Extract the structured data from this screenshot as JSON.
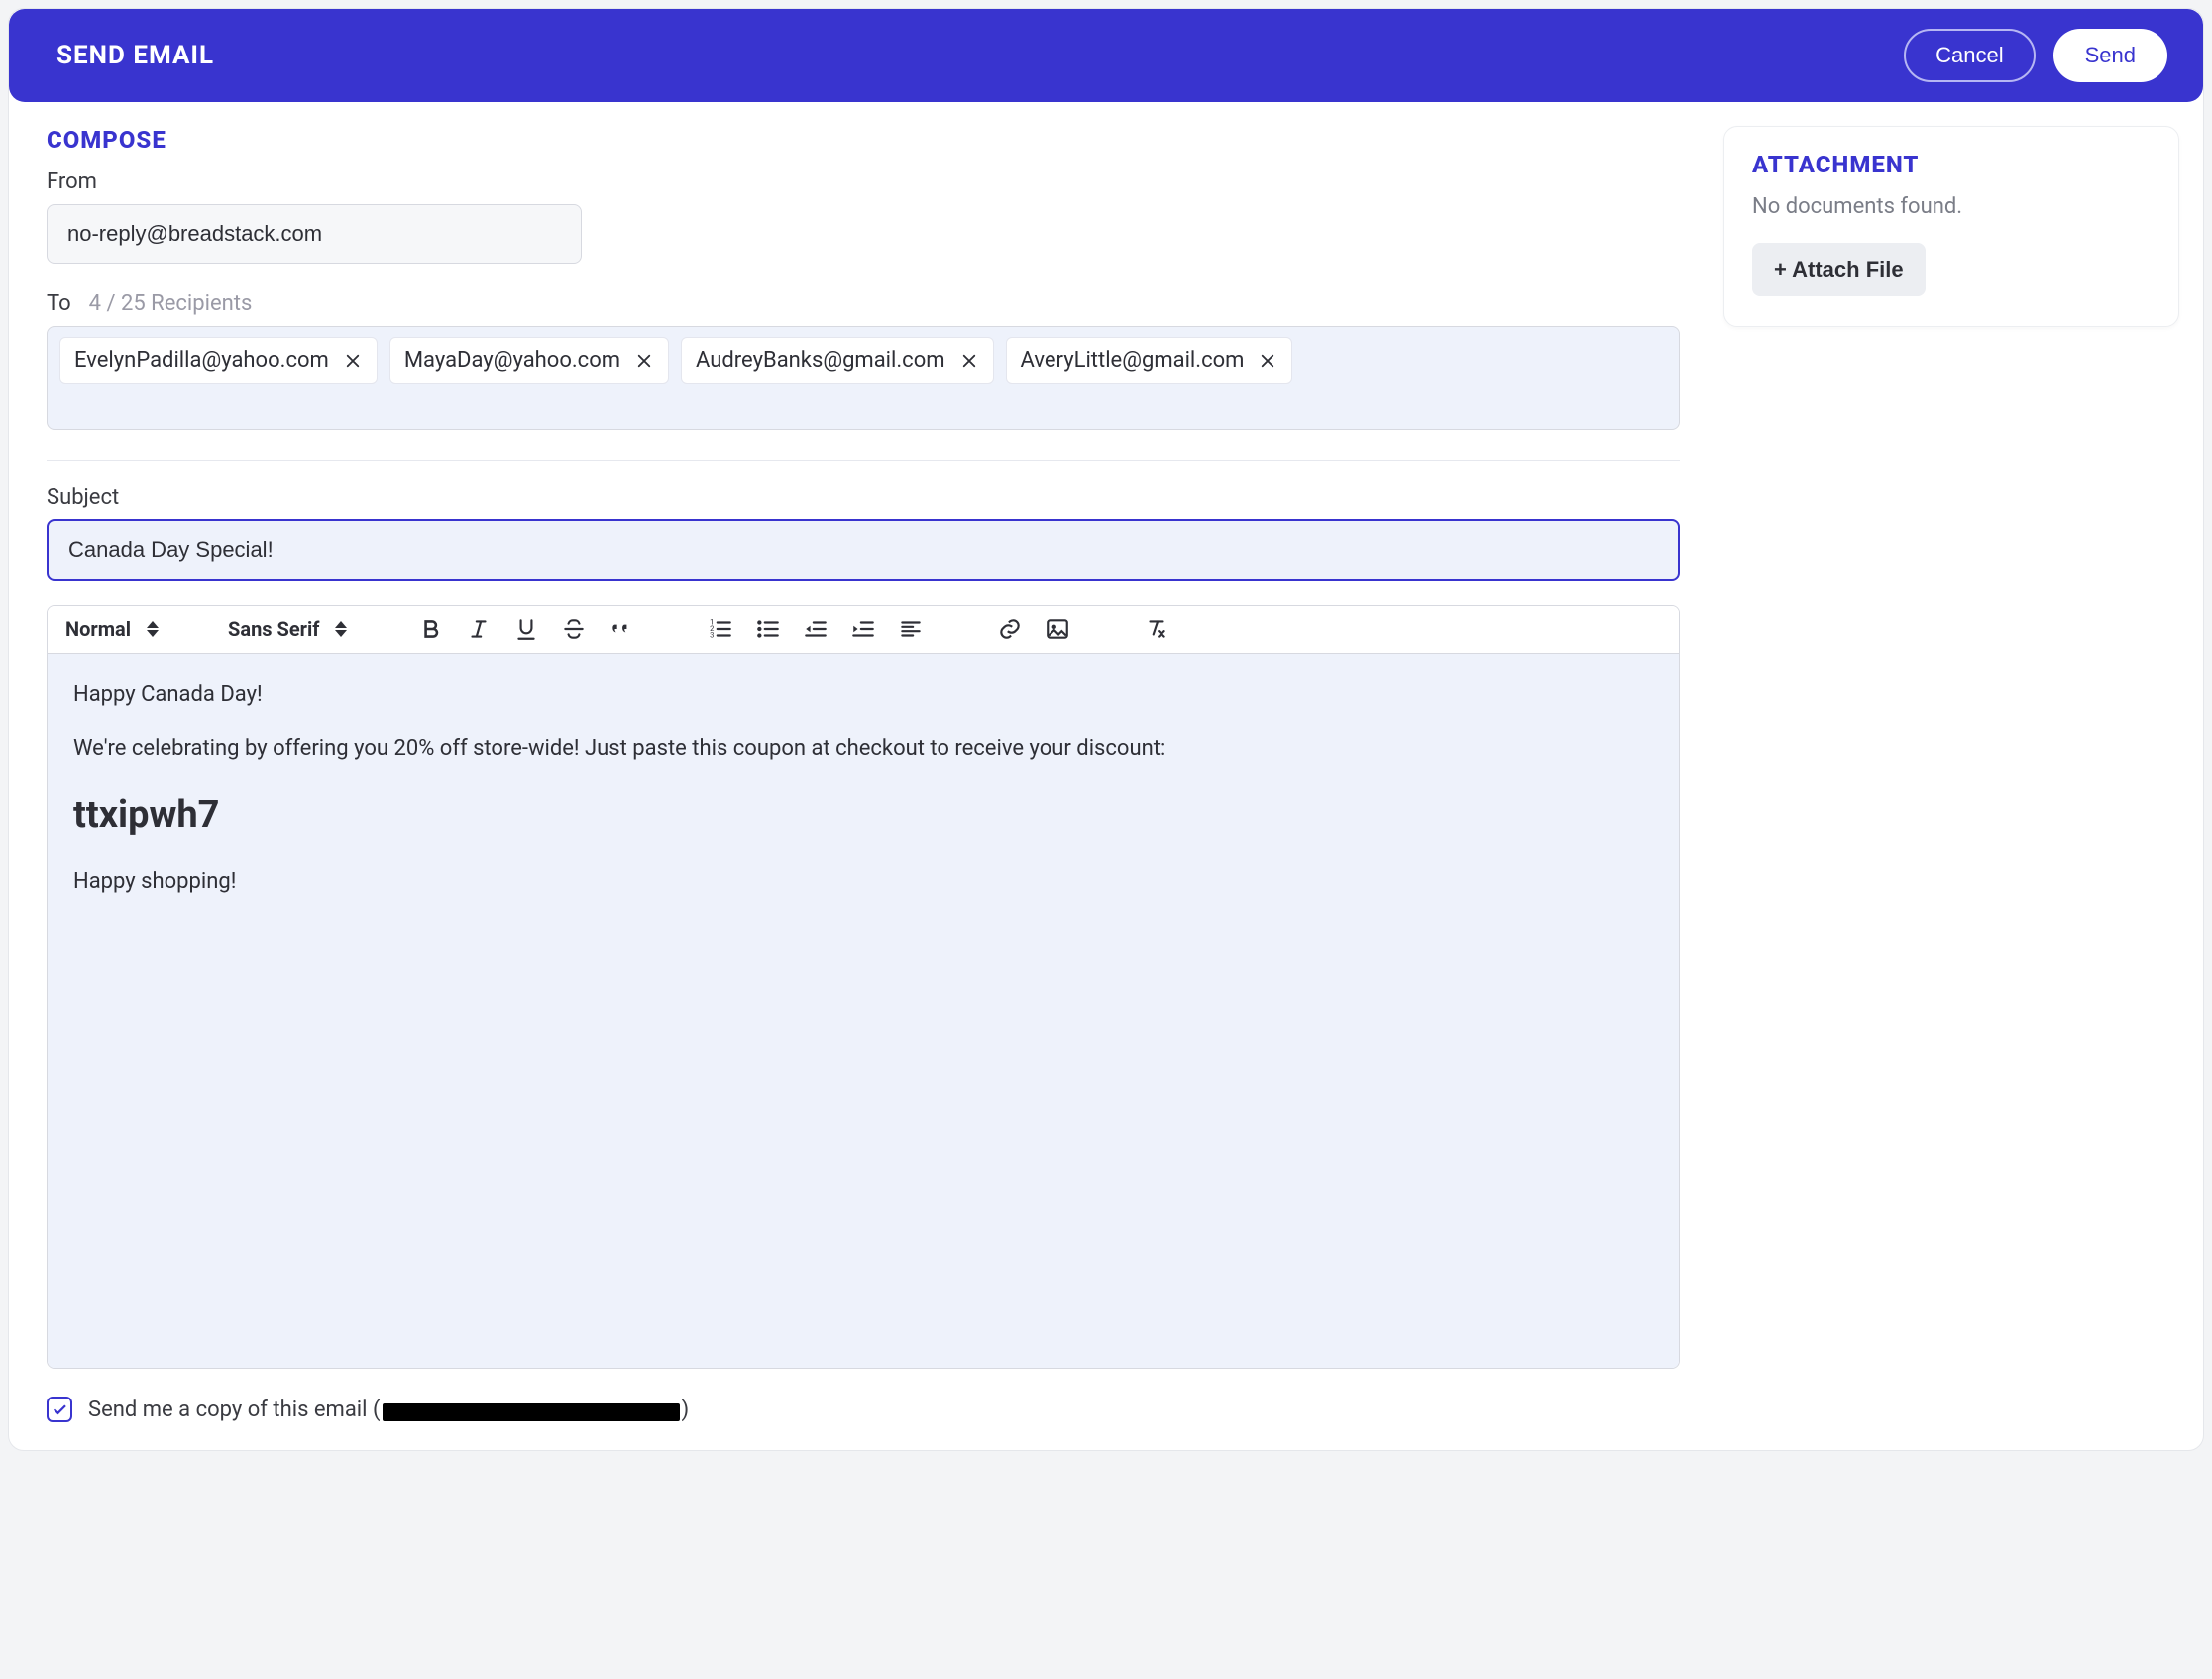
{
  "header": {
    "title": "SEND EMAIL",
    "cancel": "Cancel",
    "send": "Send"
  },
  "compose": {
    "heading": "COMPOSE",
    "from_label": "From",
    "from_value": "no-reply@breadstack.com",
    "to_label": "To",
    "recipients_count": "4 / 25 Recipients",
    "recipients": [
      "EvelynPadilla@yahoo.com",
      "MayaDay@yahoo.com",
      "AudreyBanks@gmail.com",
      "AveryLittle@gmail.com"
    ],
    "subject_label": "Subject",
    "subject_value": "Canada Day Special!",
    "toolbar": {
      "para_style": "Normal",
      "font_family": "Sans Serif"
    },
    "body": {
      "line1": "Happy Canada Day!",
      "line2": "We're celebrating by offering you 20% off store-wide! Just paste this coupon at checkout to receive your discount:",
      "coupon": "ttxipwh7",
      "line3": "Happy shopping!"
    },
    "copy_checkbox_checked": true,
    "copy_text_prefix": "Send me a copy of this email (",
    "copy_text_suffix": ")"
  },
  "attachment": {
    "heading": "ATTACHMENT",
    "empty": "No documents found.",
    "button": "+ Attach File"
  }
}
